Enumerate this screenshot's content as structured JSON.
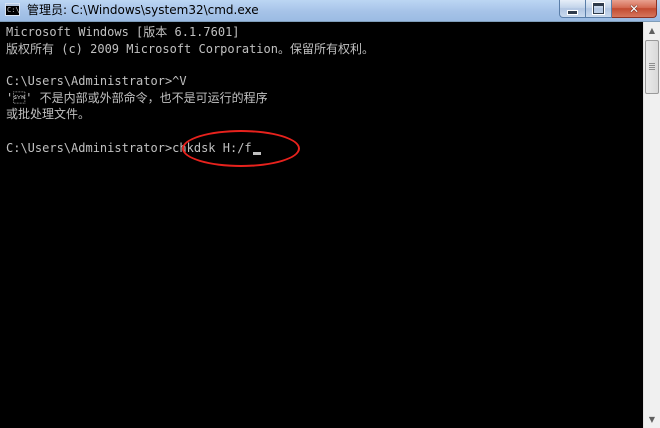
{
  "window": {
    "title": "管理员: C:\\Windows\\system32\\cmd.exe",
    "icon": "cmd-icon",
    "icon_glyph": "C:\\",
    "close_glyph": "✕",
    "accent": "#a9c4e6",
    "close_color": "#c24a30"
  },
  "console": {
    "background": "#000000",
    "text_color": "#c0c0c0",
    "lines": [
      "Microsoft Windows [版本 6.1.7601]",
      "版权所有 (c) 2009 Microsoft Corporation。保留所有权利。",
      "C:\\Users\\Administrator>^V",
      "'\u0016' 不是内部或外部命令，也不是可运行的程序",
      "或批处理文件。"
    ],
    "prompt": "C:\\Users\\Administrator>",
    "command": "chkdsk H:/f"
  },
  "annotation": {
    "color": "#e8221d",
    "shape": "ellipse"
  },
  "scrollbar": {
    "up_glyph": "▲",
    "down_glyph": "▼"
  }
}
